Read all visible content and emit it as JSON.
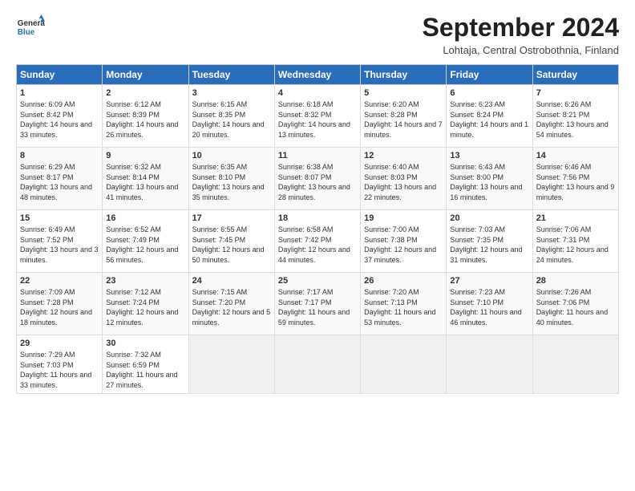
{
  "header": {
    "logo_line1": "General",
    "logo_line2": "Blue",
    "month": "September 2024",
    "location": "Lohtaja, Central Ostrobothnia, Finland"
  },
  "weekdays": [
    "Sunday",
    "Monday",
    "Tuesday",
    "Wednesday",
    "Thursday",
    "Friday",
    "Saturday"
  ],
  "weeks": [
    [
      {
        "day": "1",
        "sunrise": "Sunrise: 6:09 AM",
        "sunset": "Sunset: 8:42 PM",
        "daylight": "Daylight: 14 hours and 33 minutes."
      },
      {
        "day": "2",
        "sunrise": "Sunrise: 6:12 AM",
        "sunset": "Sunset: 8:39 PM",
        "daylight": "Daylight: 14 hours and 26 minutes."
      },
      {
        "day": "3",
        "sunrise": "Sunrise: 6:15 AM",
        "sunset": "Sunset: 8:35 PM",
        "daylight": "Daylight: 14 hours and 20 minutes."
      },
      {
        "day": "4",
        "sunrise": "Sunrise: 6:18 AM",
        "sunset": "Sunset: 8:32 PM",
        "daylight": "Daylight: 14 hours and 13 minutes."
      },
      {
        "day": "5",
        "sunrise": "Sunrise: 6:20 AM",
        "sunset": "Sunset: 8:28 PM",
        "daylight": "Daylight: 14 hours and 7 minutes."
      },
      {
        "day": "6",
        "sunrise": "Sunrise: 6:23 AM",
        "sunset": "Sunset: 8:24 PM",
        "daylight": "Daylight: 14 hours and 1 minute."
      },
      {
        "day": "7",
        "sunrise": "Sunrise: 6:26 AM",
        "sunset": "Sunset: 8:21 PM",
        "daylight": "Daylight: 13 hours and 54 minutes."
      }
    ],
    [
      {
        "day": "8",
        "sunrise": "Sunrise: 6:29 AM",
        "sunset": "Sunset: 8:17 PM",
        "daylight": "Daylight: 13 hours and 48 minutes."
      },
      {
        "day": "9",
        "sunrise": "Sunrise: 6:32 AM",
        "sunset": "Sunset: 8:14 PM",
        "daylight": "Daylight: 13 hours and 41 minutes."
      },
      {
        "day": "10",
        "sunrise": "Sunrise: 6:35 AM",
        "sunset": "Sunset: 8:10 PM",
        "daylight": "Daylight: 13 hours and 35 minutes."
      },
      {
        "day": "11",
        "sunrise": "Sunrise: 6:38 AM",
        "sunset": "Sunset: 8:07 PM",
        "daylight": "Daylight: 13 hours and 28 minutes."
      },
      {
        "day": "12",
        "sunrise": "Sunrise: 6:40 AM",
        "sunset": "Sunset: 8:03 PM",
        "daylight": "Daylight: 13 hours and 22 minutes."
      },
      {
        "day": "13",
        "sunrise": "Sunrise: 6:43 AM",
        "sunset": "Sunset: 8:00 PM",
        "daylight": "Daylight: 13 hours and 16 minutes."
      },
      {
        "day": "14",
        "sunrise": "Sunrise: 6:46 AM",
        "sunset": "Sunset: 7:56 PM",
        "daylight": "Daylight: 13 hours and 9 minutes."
      }
    ],
    [
      {
        "day": "15",
        "sunrise": "Sunrise: 6:49 AM",
        "sunset": "Sunset: 7:52 PM",
        "daylight": "Daylight: 13 hours and 3 minutes."
      },
      {
        "day": "16",
        "sunrise": "Sunrise: 6:52 AM",
        "sunset": "Sunset: 7:49 PM",
        "daylight": "Daylight: 12 hours and 56 minutes."
      },
      {
        "day": "17",
        "sunrise": "Sunrise: 6:55 AM",
        "sunset": "Sunset: 7:45 PM",
        "daylight": "Daylight: 12 hours and 50 minutes."
      },
      {
        "day": "18",
        "sunrise": "Sunrise: 6:58 AM",
        "sunset": "Sunset: 7:42 PM",
        "daylight": "Daylight: 12 hours and 44 minutes."
      },
      {
        "day": "19",
        "sunrise": "Sunrise: 7:00 AM",
        "sunset": "Sunset: 7:38 PM",
        "daylight": "Daylight: 12 hours and 37 minutes."
      },
      {
        "day": "20",
        "sunrise": "Sunrise: 7:03 AM",
        "sunset": "Sunset: 7:35 PM",
        "daylight": "Daylight: 12 hours and 31 minutes."
      },
      {
        "day": "21",
        "sunrise": "Sunrise: 7:06 AM",
        "sunset": "Sunset: 7:31 PM",
        "daylight": "Daylight: 12 hours and 24 minutes."
      }
    ],
    [
      {
        "day": "22",
        "sunrise": "Sunrise: 7:09 AM",
        "sunset": "Sunset: 7:28 PM",
        "daylight": "Daylight: 12 hours and 18 minutes."
      },
      {
        "day": "23",
        "sunrise": "Sunrise: 7:12 AM",
        "sunset": "Sunset: 7:24 PM",
        "daylight": "Daylight: 12 hours and 12 minutes."
      },
      {
        "day": "24",
        "sunrise": "Sunrise: 7:15 AM",
        "sunset": "Sunset: 7:20 PM",
        "daylight": "Daylight: 12 hours and 5 minutes."
      },
      {
        "day": "25",
        "sunrise": "Sunrise: 7:17 AM",
        "sunset": "Sunset: 7:17 PM",
        "daylight": "Daylight: 11 hours and 59 minutes."
      },
      {
        "day": "26",
        "sunrise": "Sunrise: 7:20 AM",
        "sunset": "Sunset: 7:13 PM",
        "daylight": "Daylight: 11 hours and 53 minutes."
      },
      {
        "day": "27",
        "sunrise": "Sunrise: 7:23 AM",
        "sunset": "Sunset: 7:10 PM",
        "daylight": "Daylight: 11 hours and 46 minutes."
      },
      {
        "day": "28",
        "sunrise": "Sunrise: 7:26 AM",
        "sunset": "Sunset: 7:06 PM",
        "daylight": "Daylight: 11 hours and 40 minutes."
      }
    ],
    [
      {
        "day": "29",
        "sunrise": "Sunrise: 7:29 AM",
        "sunset": "Sunset: 7:03 PM",
        "daylight": "Daylight: 11 hours and 33 minutes."
      },
      {
        "day": "30",
        "sunrise": "Sunrise: 7:32 AM",
        "sunset": "Sunset: 6:59 PM",
        "daylight": "Daylight: 11 hours and 27 minutes."
      },
      {
        "day": "",
        "sunrise": "",
        "sunset": "",
        "daylight": ""
      },
      {
        "day": "",
        "sunrise": "",
        "sunset": "",
        "daylight": ""
      },
      {
        "day": "",
        "sunrise": "",
        "sunset": "",
        "daylight": ""
      },
      {
        "day": "",
        "sunrise": "",
        "sunset": "",
        "daylight": ""
      },
      {
        "day": "",
        "sunrise": "",
        "sunset": "",
        "daylight": ""
      }
    ]
  ]
}
